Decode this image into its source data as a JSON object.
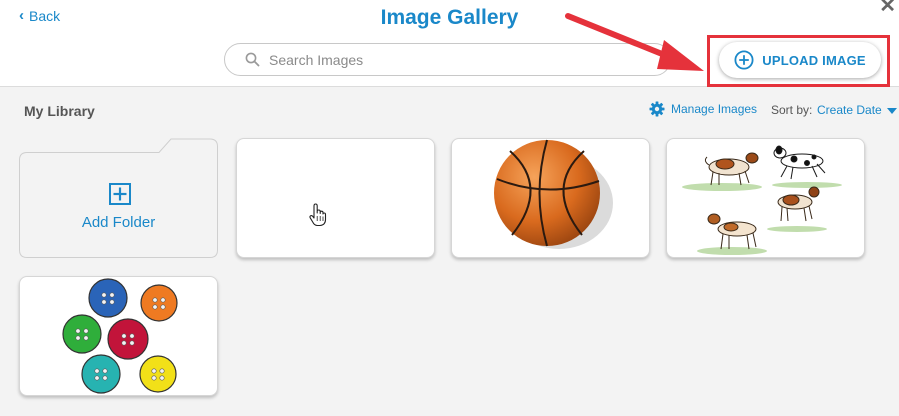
{
  "header": {
    "back_label": "Back",
    "title": "Image Gallery",
    "search_placeholder": "Search Images",
    "upload_label": "UPLOAD IMAGE"
  },
  "library": {
    "title": "My Library",
    "manage_label": "Manage Images",
    "sort_label": "Sort by:",
    "sort_value": "Create Date"
  },
  "folder": {
    "add_label": "Add Folder"
  },
  "images": [
    {
      "subject": "blank"
    },
    {
      "subject": "basketball"
    },
    {
      "subject": "dogs"
    },
    {
      "subject": "buttons"
    }
  ],
  "colors": {
    "accent": "#1a88c9",
    "highlight": "#e5323b",
    "background": "#f3f3f3"
  }
}
